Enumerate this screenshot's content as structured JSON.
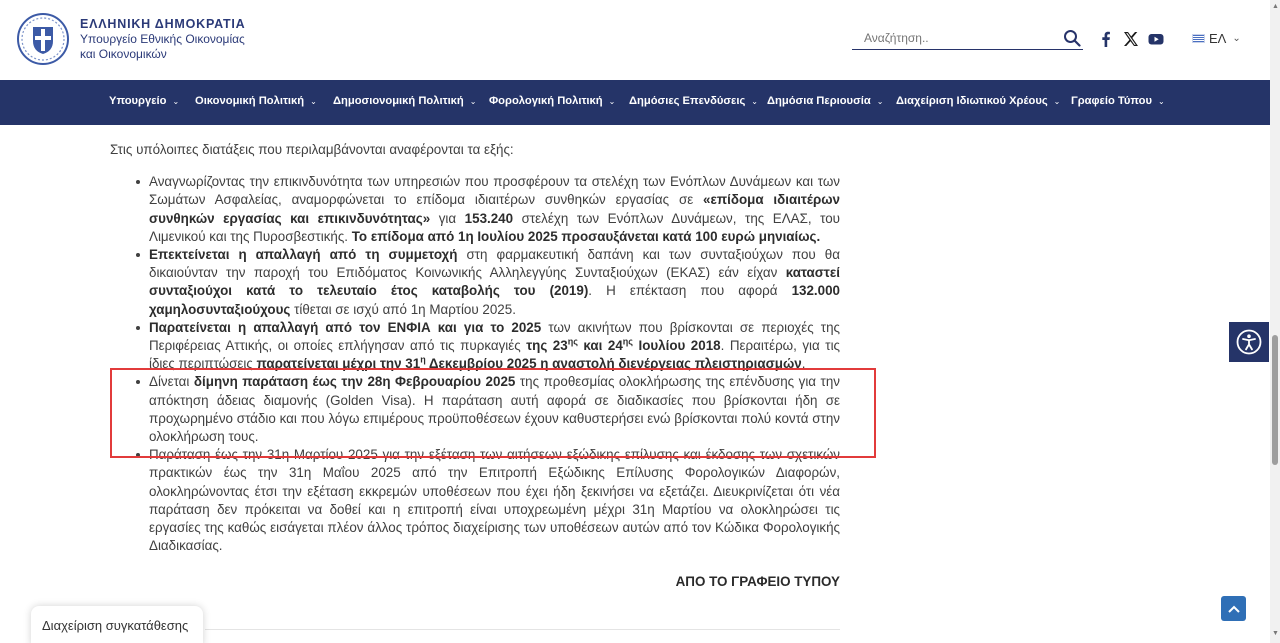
{
  "header": {
    "logo_title": "ΕΛΛΗΝΙΚΗ ΔΗΜΟΚΡΑΤΙΑ",
    "logo_sub1": "Υπουργείο Εθνικής Οικονομίας",
    "logo_sub2": "και Οικονομικών",
    "search_placeholder": "Αναζήτηση..",
    "social": [
      "facebook-icon",
      "x-icon",
      "youtube-icon"
    ],
    "language": "ΕΛ"
  },
  "nav": {
    "items": [
      "Υπουργείο",
      "Οικονομική Πολιτική",
      "Δημοσιονομική Πολιτική",
      "Φορολογική Πολιτική",
      "Δημόσιες Επενδύσεις",
      "Δημόσια Περιουσία",
      "Διαχείριση Ιδιωτικού Χρέους",
      "Γραφείο Τύπου"
    ]
  },
  "content": {
    "intro": "Στις υπόλοιπες διατάξεις που περιλαμβάνονται αναφέρονται τα εξής:",
    "b1": {
      "t1": "Αναγνωρίζοντας την επικινδυνότητα των υπηρεσιών που προσφέρουν τα στελέχη των Ενόπλων Δυνάμεων και των Σωμάτων Ασφαλείας, αναμορφώνεται το επίδομα ιδιαιτέρων συνθηκών εργασίας σε ",
      "b1": "«επίδομα ιδιαιτέρων συνθηκών εργασίας και επικινδυνότητας»",
      "t2": " για ",
      "b2": "153.240",
      "t3": " στελέχη των Ενόπλων Δυνάμεων, της ΕΛΑΣ, του Λιμενικού και της Πυροσβεστικής. ",
      "b3": "Το επίδομα από 1η Ιουλίου 2025 προσαυξάνεται κατά 100 ευρώ μηνιαίως."
    },
    "b2": {
      "b1": "Επεκτείνεται η απαλλαγή από τη συμμετοχή",
      "t1": " στη φαρμακευτική δαπάνη και των συνταξιούχων που θα δικαιούνταν την παροχή του Επιδόματος Κοινωνικής Αλληλεγγύης Συνταξιούχων (ΕΚΑΣ) εάν είχαν ",
      "b2": "καταστεί συνταξιούχοι κατά το τελευταίο έτος καταβολής του (2019)",
      "t2": ". Η επέκταση που αφορά ",
      "b3": "132.000 χαμηλοσυνταξιούχους",
      "t3": " τίθεται σε ισχύ από 1η Μαρτίου 2025."
    },
    "b3": {
      "b1": "Παρατείνεται η απαλλαγή από τον ΕΝΦΙΑ και για το 2025",
      "t1": " των ακινήτων που βρίσκονται σε περιοχές της Περιφέρειας Αττικής, οι οποίες επλήγησαν από τις πυρκαγιές ",
      "b2a": "της 23",
      "b2s": "ης",
      "b2b": " και 24",
      "b2s2": "ης",
      "b2c": " Ιουλίου 2018",
      "t2": ". Περαιτέρω, για τις ίδιες περιπτώσεις ",
      "b3a": "παρατείνεται μέχρι την 31",
      "b3s": "η",
      "b3b": " Δεκεμβρίου 2025 η αναστολή διενέργειας πλειστηριασμών",
      "t3": "."
    },
    "b4": {
      "t1": "Δίνεται ",
      "b1": "δίμηνη παράταση έως την 28η Φεβρουαρίου 2025",
      "t2": " της προθεσμίας ολοκλήρωσης της επένδυσης για την απόκτηση άδειας διαμονής (Golden Visa). Η παράταση αυτή αφορά σε διαδικασίες που βρίσκονται ήδη σε προχωρημένο στάδιο και που λόγω επιμέρους προϋποθέσεων έχουν καθυστερήσει ενώ βρίσκονται πολύ κοντά στην ολοκλήρωση τους."
    },
    "b5": "Παράταση έως την 31η Μαρτίου 2025 για την εξέταση των αιτήσεων εξώδικης επίλυσης και έκδοσης των σχετικών πρακτικών έως την 31η Μαΐου 2025 από την Επιτροπή Εξώδικης Επίλυσης Φορολογικών Διαφορών, ολοκληρώνοντας έτσι την εξέταση εκκρεμών υποθέσεων που έχει ήδη ξεκινήσει να εξετάζει. Διευκρινίζεται ότι νέα παράταση δεν πρόκειται να δοθεί και η επιτροπή είναι υποχρεωμένη μέχρι 31η Μαρτίου να ολοκληρώσει τις εργασίες της καθώς εισάγεται πλέον άλλος τρόπος διαχείρισης των υποθέσεων αυτών από τον Κώδικα Φορολογικής Διαδικασίας.",
    "signature": "ΑΠΟ ΤΟ ΓΡΑΦΕΙΟ ΤΥΠΟΥ"
  },
  "consent": {
    "label": "Διαχείριση συγκατάθεσης"
  },
  "colors": {
    "nav_bg": "#253468",
    "highlight": "#e23b3b",
    "scroll_top": "#2f6fb6"
  }
}
